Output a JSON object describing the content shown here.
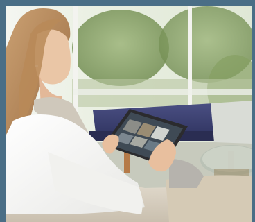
{
  "image": {
    "subject": "woman-using-tablet-on-sofa",
    "colors": {
      "frame": "#4a6e86",
      "window_light": "#eef2ea",
      "garden_green": "#7f9a5a",
      "sofa": "#d8d0c3",
      "ottoman": "#3b3f6e",
      "sweater": "#f6f6f4",
      "hair": "#b88a5a",
      "skin": "#e9c2a2",
      "tablet": "#2b2b2e"
    },
    "tablet_screen_tiles": 6
  }
}
